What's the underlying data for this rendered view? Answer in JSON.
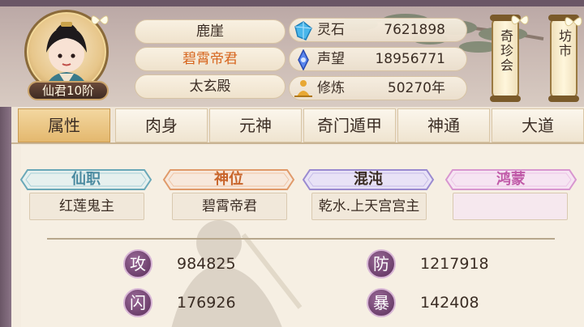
{
  "player": {
    "rank": "仙君10阶",
    "names": [
      "鹿崖",
      "碧霄帝君",
      "太玄殿"
    ]
  },
  "resources": [
    {
      "label": "灵石",
      "value": "7621898",
      "icon": "crystal-icon",
      "color": "#3aa8e0"
    },
    {
      "label": "声望",
      "value": "18956771",
      "icon": "reputation-gem-icon",
      "color": "#4a7ae8"
    },
    {
      "label": "修炼",
      "value": "50270年",
      "icon": "meditation-icon",
      "color": "#e0a030"
    }
  ],
  "side_buttons": [
    {
      "label": "奇珍会"
    },
    {
      "label": "坊市"
    }
  ],
  "tabs": [
    {
      "label": "属性",
      "active": true
    },
    {
      "label": "肉身",
      "active": false
    },
    {
      "label": "元神",
      "active": false
    },
    {
      "label": "奇门遁甲",
      "active": false
    },
    {
      "label": "神通",
      "active": false
    },
    {
      "label": "大道",
      "active": false
    }
  ],
  "titles": [
    {
      "header": "仙职",
      "value": "红莲鬼主",
      "color": "#6aa8b8",
      "text_color": "#4a8aa0"
    },
    {
      "header": "神位",
      "value": "碧霄帝君",
      "color": "#e09a6a",
      "text_color": "#c8642a"
    },
    {
      "header": "混沌",
      "value": "乾水.上天宫宫主",
      "color": "#9a8ad0",
      "text_color": "#3b2d24"
    },
    {
      "header": "鸿蒙",
      "value": "",
      "color": "#d896d0",
      "text_color": "#c05aa8"
    }
  ],
  "attributes": [
    {
      "badge": "攻",
      "value": "984825"
    },
    {
      "badge": "防",
      "value": "1217918"
    },
    {
      "badge": "闪",
      "value": "176926"
    },
    {
      "badge": "暴",
      "value": "142408"
    }
  ]
}
